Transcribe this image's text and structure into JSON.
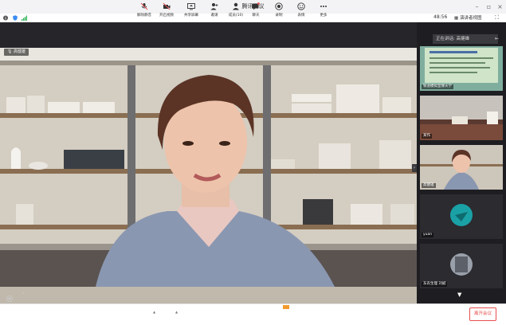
{
  "window": {
    "title": "腾讯会议"
  },
  "infobar": {
    "time": "48:56",
    "view_label": "演讲者视图"
  },
  "main": {
    "speaker_tag": "高健雄"
  },
  "sidebar": {
    "speaking_label": "正在讲话: 高健雄",
    "thumbs": [
      {
        "label": "铁道模拟室哪天学"
      },
      {
        "label": "某作"
      },
      {
        "label": "高健雄"
      },
      {
        "label": "yuan"
      },
      {
        "label": "东农生理 刘斌"
      }
    ]
  },
  "toolbar": {
    "items": [
      {
        "label": "解除静音",
        "icon": "mic-muted-icon"
      },
      {
        "label": "开启视频",
        "icon": "camera-off-icon"
      },
      {
        "label": "共享屏幕",
        "icon": "share-screen-icon"
      },
      {
        "label": "邀请",
        "icon": "invite-icon"
      },
      {
        "label": "成员(10)",
        "icon": "members-icon"
      },
      {
        "label": "聊天",
        "icon": "chat-icon"
      },
      {
        "label": "录制",
        "icon": "record-icon"
      },
      {
        "label": "表情",
        "icon": "emoji-icon"
      },
      {
        "label": "更多",
        "icon": "more-icon"
      }
    ],
    "leave_label": "离开会议"
  },
  "colors": {
    "leave": "#e84e4e",
    "accent": "#3b8cf2",
    "panel": "#1e1e22"
  }
}
